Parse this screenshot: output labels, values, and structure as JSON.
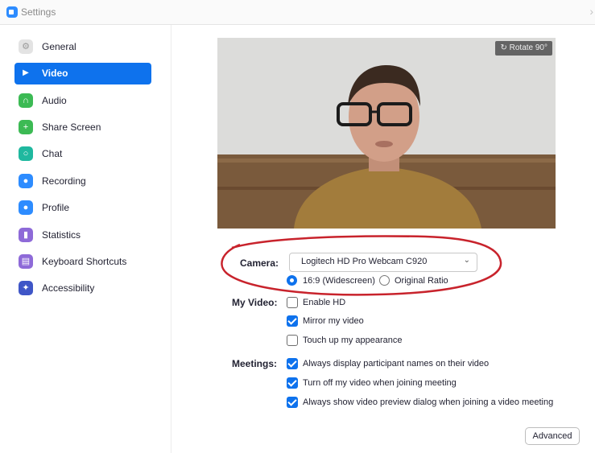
{
  "window": {
    "title": "Settings",
    "close_glyph": "›"
  },
  "sidebar": {
    "items": [
      {
        "label": "General",
        "icon": "gear-icon",
        "color": "#d0d0d0",
        "glyph": "⚙",
        "active": false
      },
      {
        "label": "Video",
        "icon": "video-camera-icon",
        "color": "#ffffff",
        "glyph": "▶",
        "active": true
      },
      {
        "label": "Audio",
        "icon": "headphones-icon",
        "color": "#3cba54",
        "glyph": "∩",
        "active": false
      },
      {
        "label": "Share Screen",
        "icon": "share-screen-icon",
        "color": "#3cba54",
        "glyph": "+",
        "active": false
      },
      {
        "label": "Chat",
        "icon": "chat-icon",
        "color": "#1fb89f",
        "glyph": "○",
        "active": false
      },
      {
        "label": "Recording",
        "icon": "recording-icon",
        "color": "#2D8CFF",
        "glyph": "●",
        "active": false
      },
      {
        "label": "Profile",
        "icon": "profile-icon",
        "color": "#2D8CFF",
        "glyph": "●",
        "active": false
      },
      {
        "label": "Statistics",
        "icon": "statistics-icon",
        "color": "#8e6ad8",
        "glyph": "▮",
        "active": false
      },
      {
        "label": "Keyboard Shortcuts",
        "icon": "keyboard-icon",
        "color": "#8e6ad8",
        "glyph": "▤",
        "active": false
      },
      {
        "label": "Accessibility",
        "icon": "accessibility-icon",
        "color": "#3f56c7",
        "glyph": "✦",
        "active": false
      }
    ]
  },
  "preview": {
    "rotate_label": "↻ Rotate 90°"
  },
  "camera": {
    "label": "Camera:",
    "selected": "Logitech HD Pro Webcam C920",
    "ratio_options": [
      {
        "label": "16:9 (Widescreen)",
        "selected": true
      },
      {
        "label": "Original Ratio",
        "selected": false
      }
    ]
  },
  "my_video": {
    "label": "My Video:",
    "options": [
      {
        "label": "Enable HD",
        "checked": false
      },
      {
        "label": "Mirror my video",
        "checked": true
      },
      {
        "label": "Touch up my appearance",
        "checked": false
      }
    ]
  },
  "meetings": {
    "label": "Meetings:",
    "options": [
      {
        "label": "Always display participant names on their video",
        "checked": true
      },
      {
        "label": "Turn off my video when joining meeting",
        "checked": true
      },
      {
        "label": "Always show video preview dialog when joining a video meeting",
        "checked": true
      }
    ]
  },
  "advanced_button": "Advanced",
  "colors": {
    "accent": "#0E72ED",
    "annotation": "#c8232c"
  }
}
